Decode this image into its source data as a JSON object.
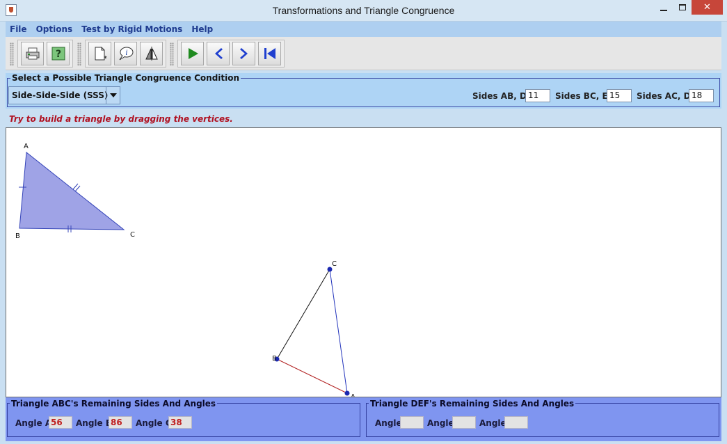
{
  "window": {
    "title": "Transformations and Triangle Congruence",
    "close_glyph": "✕"
  },
  "menu": [
    "File",
    "Options",
    "Test by Rigid Motions",
    "Help"
  ],
  "toolbar": {
    "groups": [
      [
        "print-icon",
        "help-icon"
      ],
      [
        "new-page-icon",
        "info-speech-icon",
        "reflect-icon"
      ],
      [
        "play-icon",
        "previous-icon",
        "next-icon",
        "first-icon"
      ]
    ]
  },
  "condition": {
    "legend": "Select a Possible Triangle Congruence Condition",
    "selected": "Side-Side-Side (SSS)",
    "sides": [
      {
        "label": "Sides AB, DE",
        "value": "11"
      },
      {
        "label": "Sides BC, EF",
        "value": "15"
      },
      {
        "label": "Sides AC, DF",
        "value": "18"
      }
    ]
  },
  "message": "Try to build a triangle by dragging the vertices.",
  "canvas": {
    "triangle_abc": {
      "fill": "#9fa3e6",
      "stroke": "#3444b8",
      "labels": {
        "A": "A",
        "B": "B",
        "C": "C"
      }
    },
    "triangle_def": {
      "labels": {
        "C": "C",
        "B": "B",
        "A": "A"
      },
      "edge_colors": {
        "AB": "#b22222",
        "BC": "#111111",
        "CA": "#2233bb"
      },
      "vertex_color": "#1a28b0"
    }
  },
  "abc_panel": {
    "legend": "Triangle ABC's Remaining Sides And Angles",
    "angles": [
      {
        "label": "Angle A",
        "value": "56"
      },
      {
        "label": "Angle B",
        "value": "86"
      },
      {
        "label": "Angle C",
        "value": "38"
      }
    ]
  },
  "def_panel": {
    "legend": "Triangle DEF's Remaining Sides And Angles",
    "angles": [
      {
        "label": "Angle",
        "value": ""
      },
      {
        "label": "Angle",
        "value": ""
      },
      {
        "label": "Angle",
        "value": ""
      }
    ]
  }
}
